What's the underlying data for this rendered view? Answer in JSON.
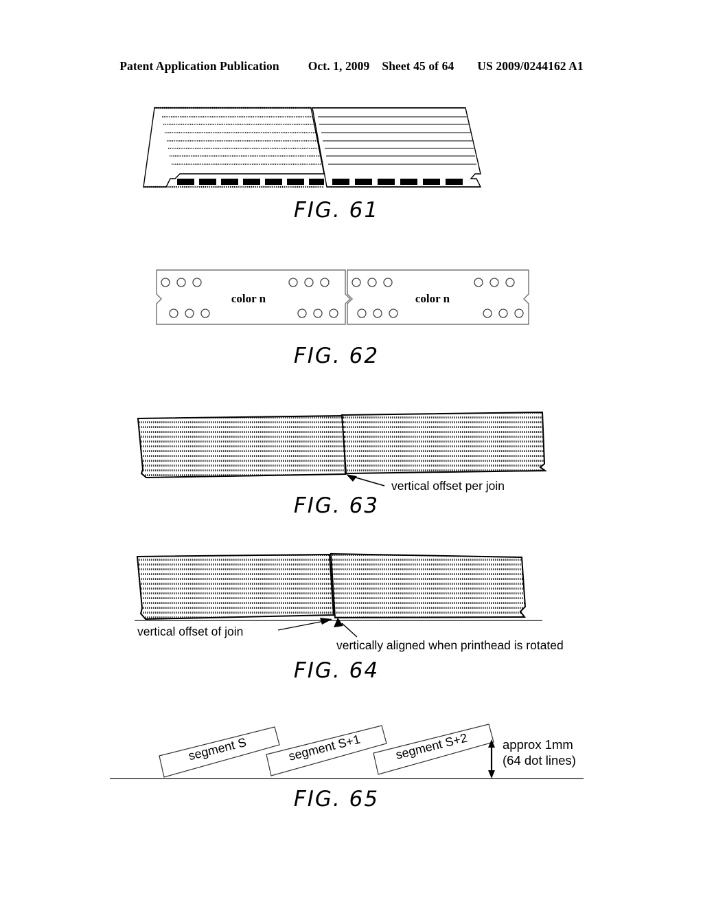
{
  "header": {
    "publication": "Patent Application Publication",
    "date": "Oct. 1, 2009",
    "sheet": "Sheet 45 of 64",
    "number": "US 2009/0244162 A1"
  },
  "figures": [
    {
      "id": "fig61",
      "caption": "FIG. 61",
      "description": "Two adjacent printhead segments with horizontal dot rows and nozzle bars along the bottom edge",
      "labels": []
    },
    {
      "id": "fig62",
      "caption": "FIG. 62",
      "description": "Two abutting printhead segment outlines each containing nozzle groups",
      "labels": [
        "color n",
        "color n"
      ]
    },
    {
      "id": "fig63",
      "caption": "FIG. 63",
      "description": "Two sloping hatched printhead segments joined with a step",
      "labels": [
        "vertical offset per join"
      ]
    },
    {
      "id": "fig64",
      "caption": "FIG. 64",
      "description": "Two sloping hatched printhead segments sitting on a baseline",
      "labels": [
        "vertical offset of join",
        "vertically aligned when printhead is rotated"
      ]
    },
    {
      "id": "fig65",
      "caption": "FIG. 65",
      "description": "Three tilted overlapping segment rectangles rising along a baseline",
      "labels": [
        "segment S",
        "segment S+1",
        "segment S+2",
        "approx 1mm",
        "(64 dot lines)"
      ]
    }
  ],
  "fig62": {
    "left_label": "color n",
    "right_label": "color n"
  },
  "fig63": {
    "offset_label": "vertical offset per join"
  },
  "fig64": {
    "offset_label": "vertical offset of join",
    "aligned_label": "vertically aligned when printhead is rotated"
  },
  "fig65": {
    "segment_1": "segment S",
    "segment_2": "segment S+1",
    "segment_3": "segment S+2",
    "scale_line_1": "approx 1mm",
    "scale_line_2": "(64 dot lines)"
  },
  "colors": {
    "ink": "#000000",
    "hatch": "#555555",
    "paper": "#ffffff"
  }
}
